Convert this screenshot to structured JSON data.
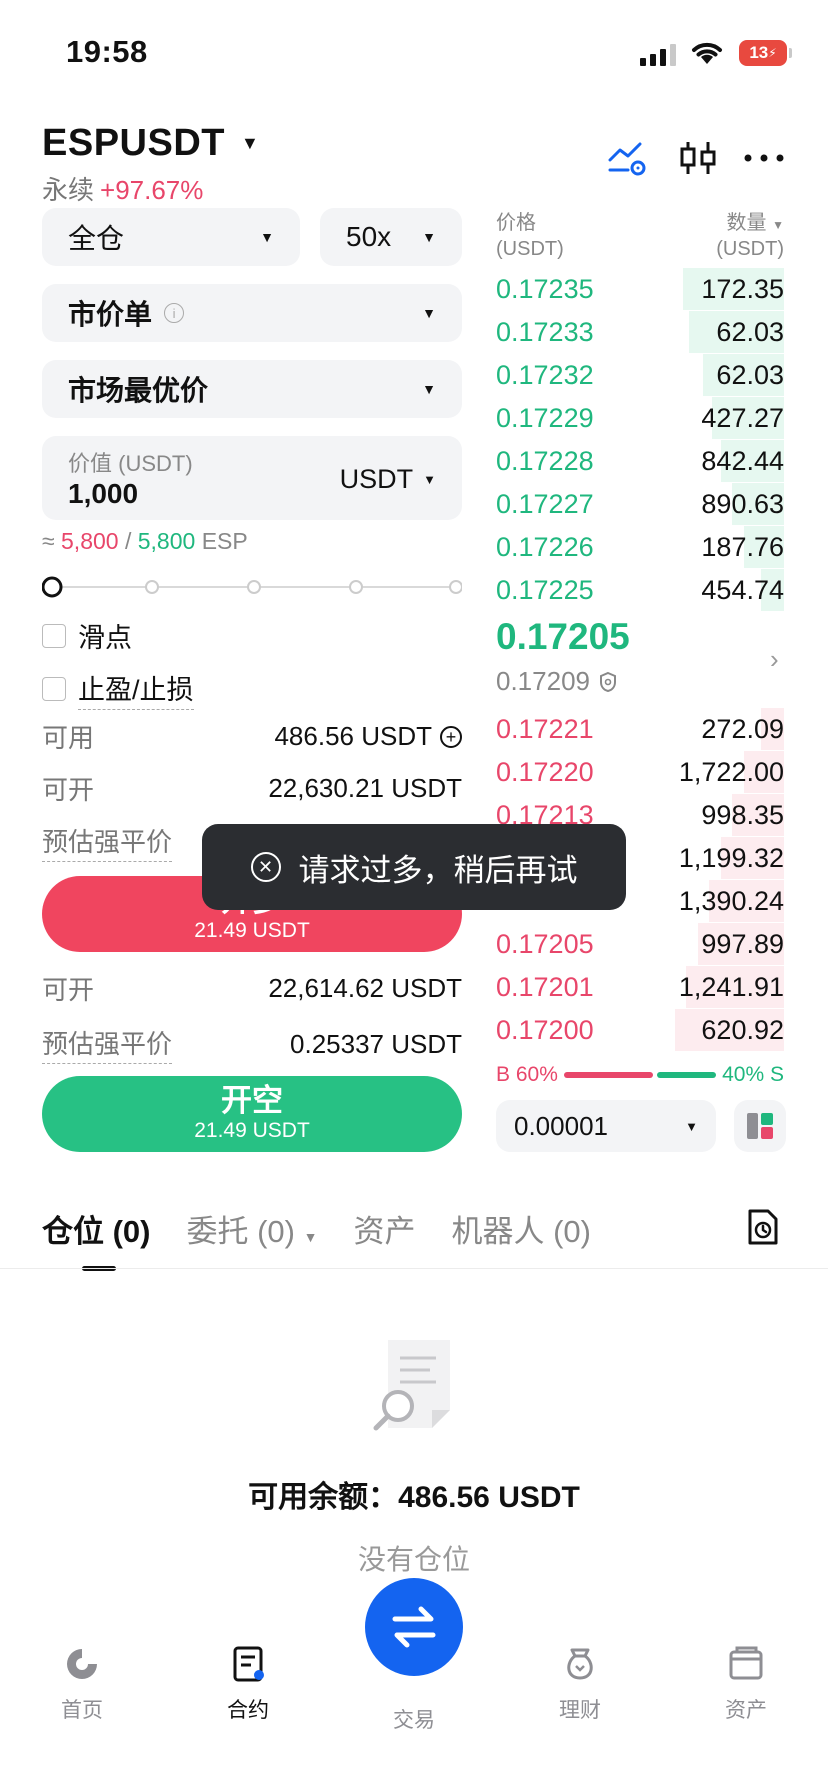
{
  "status_bar": {
    "time": "19:58",
    "battery": "13"
  },
  "header": {
    "pair": "ESPUSDT",
    "type": "永续",
    "change": "+97.67%"
  },
  "form": {
    "margin_mode": "全仓",
    "leverage": "50x",
    "order_type": "市价单",
    "price_type": "市场最优价",
    "value_label": "价值 (USDT)",
    "value": "1,000",
    "value_unit": "USDT",
    "approx_prefix": "≈",
    "approx_buy": "5,800",
    "approx_sep": "/",
    "approx_sell": "5,800",
    "approx_unit": "ESP",
    "slider_percent": 0,
    "slippage_label": "滑点",
    "tpsl_label": "止盈/止损",
    "long": {
      "available_label": "可用",
      "available_value": "486.56 USDT",
      "openable_label": "可开",
      "openable_value": "22,630.21 USDT",
      "liq_label": "预估强平价",
      "button_label": "开多",
      "button_sub": "21.49 USDT"
    },
    "short": {
      "openable_label": "可开",
      "openable_value": "22,614.62 USDT",
      "liq_label": "预估强平价",
      "liq_value": "0.25337 USDT",
      "button_label": "开空",
      "button_sub": "21.49 USDT"
    }
  },
  "order_book": {
    "price_header": "价格",
    "price_unit": "(USDT)",
    "qty_header": "数量",
    "qty_unit": "(USDT)",
    "asks": [
      {
        "price": "0.17235",
        "qty": "172.35",
        "depth": 0.35
      },
      {
        "price": "0.17233",
        "qty": "62.03",
        "depth": 0.33
      },
      {
        "price": "0.17232",
        "qty": "62.03",
        "depth": 0.28
      },
      {
        "price": "0.17229",
        "qty": "427.27",
        "depth": 0.25
      },
      {
        "price": "0.17228",
        "qty": "842.44",
        "depth": 0.22
      },
      {
        "price": "0.17227",
        "qty": "890.63",
        "depth": 0.18
      },
      {
        "price": "0.17226",
        "qty": "187.76",
        "depth": 0.14
      },
      {
        "price": "0.17225",
        "qty": "454.74",
        "depth": 0.08
      }
    ],
    "last_price": "0.17205",
    "mark_price": "0.17209",
    "bids": [
      {
        "price": "0.17221",
        "qty": "272.09",
        "depth": 0.08
      },
      {
        "price": "0.17220",
        "qty": "1,722.00",
        "depth": 0.14
      },
      {
        "price": "0.17213",
        "qty": "998.35",
        "depth": 0.18
      },
      {
        "price": "",
        "qty": "1,199.32",
        "depth": 0.22
      },
      {
        "price": "",
        "qty": "1,390.24",
        "depth": 0.26
      },
      {
        "price": "0.17205",
        "qty": "997.89",
        "depth": 0.3
      },
      {
        "price": "0.17201",
        "qty": "1,241.91",
        "depth": 0.34
      },
      {
        "price": "0.17200",
        "qty": "620.92",
        "depth": 0.38
      }
    ],
    "buy_ratio": "B 60%",
    "sell_ratio": "40% S",
    "buy_fraction": 0.6,
    "precision": "0.00001"
  },
  "tabs": [
    {
      "label": "仓位 (0)"
    },
    {
      "label": "委托 (0)"
    },
    {
      "label": "资产"
    },
    {
      "label": "机器人 (0)"
    }
  ],
  "empty": {
    "available": "可用余额：486.56 USDT",
    "no_position": "没有仓位"
  },
  "toast": {
    "message": "请求过多，稍后再试"
  },
  "nav": {
    "home": "首页",
    "contract": "合约",
    "trade": "交易",
    "finance": "理财",
    "assets": "资产"
  },
  "colors": {
    "green": "#1fb77e",
    "red": "#e8466a",
    "blue": "#1464f0"
  }
}
